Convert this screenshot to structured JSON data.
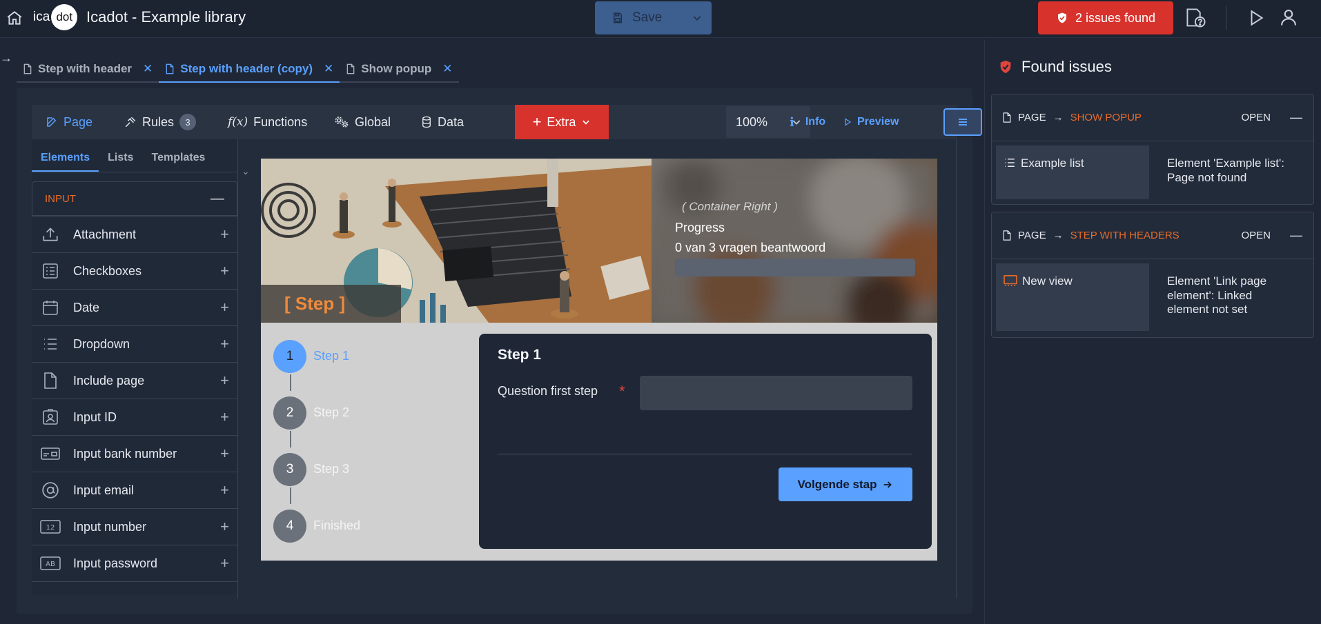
{
  "app": {
    "logo_left": "ica",
    "logo_right": "dot",
    "title": "Icadot - Example library"
  },
  "header": {
    "save_label": "Save",
    "issues_label": "2 issues found"
  },
  "tabs": [
    {
      "label": "Step with header",
      "active": false
    },
    {
      "label": "Step with header (copy)",
      "active": true
    },
    {
      "label": "Show popup",
      "active": false
    }
  ],
  "toolbar": {
    "page": "Page",
    "rules": "Rules",
    "rules_count": "3",
    "functions": "Functions",
    "global": "Global",
    "data": "Data",
    "extra": "Extra",
    "zoom": "100%",
    "info": "Info",
    "preview": "Preview"
  },
  "panel": {
    "tabs": [
      "Elements",
      "Lists",
      "Templates"
    ],
    "section": "INPUT",
    "elements": [
      {
        "label": "Attachment",
        "icon": "upload-icon"
      },
      {
        "label": "Checkboxes",
        "icon": "checklist-icon"
      },
      {
        "label": "Date",
        "icon": "calendar-icon"
      },
      {
        "label": "Dropdown",
        "icon": "list-icon"
      },
      {
        "label": "Include page",
        "icon": "file-icon"
      },
      {
        "label": "Input ID",
        "icon": "id-badge-icon"
      },
      {
        "label": "Input bank number",
        "icon": "bank-card-icon"
      },
      {
        "label": "Input email",
        "icon": "at-icon"
      },
      {
        "label": "Input number",
        "icon": "number-icon"
      },
      {
        "label": "Input password",
        "icon": "password-icon"
      }
    ]
  },
  "preview": {
    "step_label": "[ Step ]",
    "container_right": "( Container Right )",
    "progress_label": "Progress",
    "progress_text": "0 van 3 vragen beantwoord",
    "progress": 0,
    "steps": [
      {
        "num": "1",
        "label": "Step 1",
        "active": true
      },
      {
        "num": "2",
        "label": "Step 2",
        "active": false
      },
      {
        "num": "3",
        "label": "Step 3",
        "active": false
      },
      {
        "num": "4",
        "label": "Finished",
        "active": false
      }
    ],
    "form_title": "Step 1",
    "question_label": "Question first step",
    "required_mark": "*",
    "next_button": "Volgende stap"
  },
  "issues_panel": {
    "title": "Found issues",
    "issues": [
      {
        "scope": "PAGE",
        "target": "SHOW POPUP",
        "status": "OPEN",
        "element": "Example list",
        "element_icon": "list-icon",
        "message": "Element 'Example list': Page not found"
      },
      {
        "scope": "PAGE",
        "target": "STEP WITH HEADERS",
        "status": "OPEN",
        "element": "New view",
        "element_icon": "view-icon",
        "message": "Element 'Link page element': Linked element not set"
      }
    ]
  },
  "colors": {
    "accent": "#5aa0ff",
    "danger": "#d8322d",
    "warning": "#e86b2a"
  }
}
